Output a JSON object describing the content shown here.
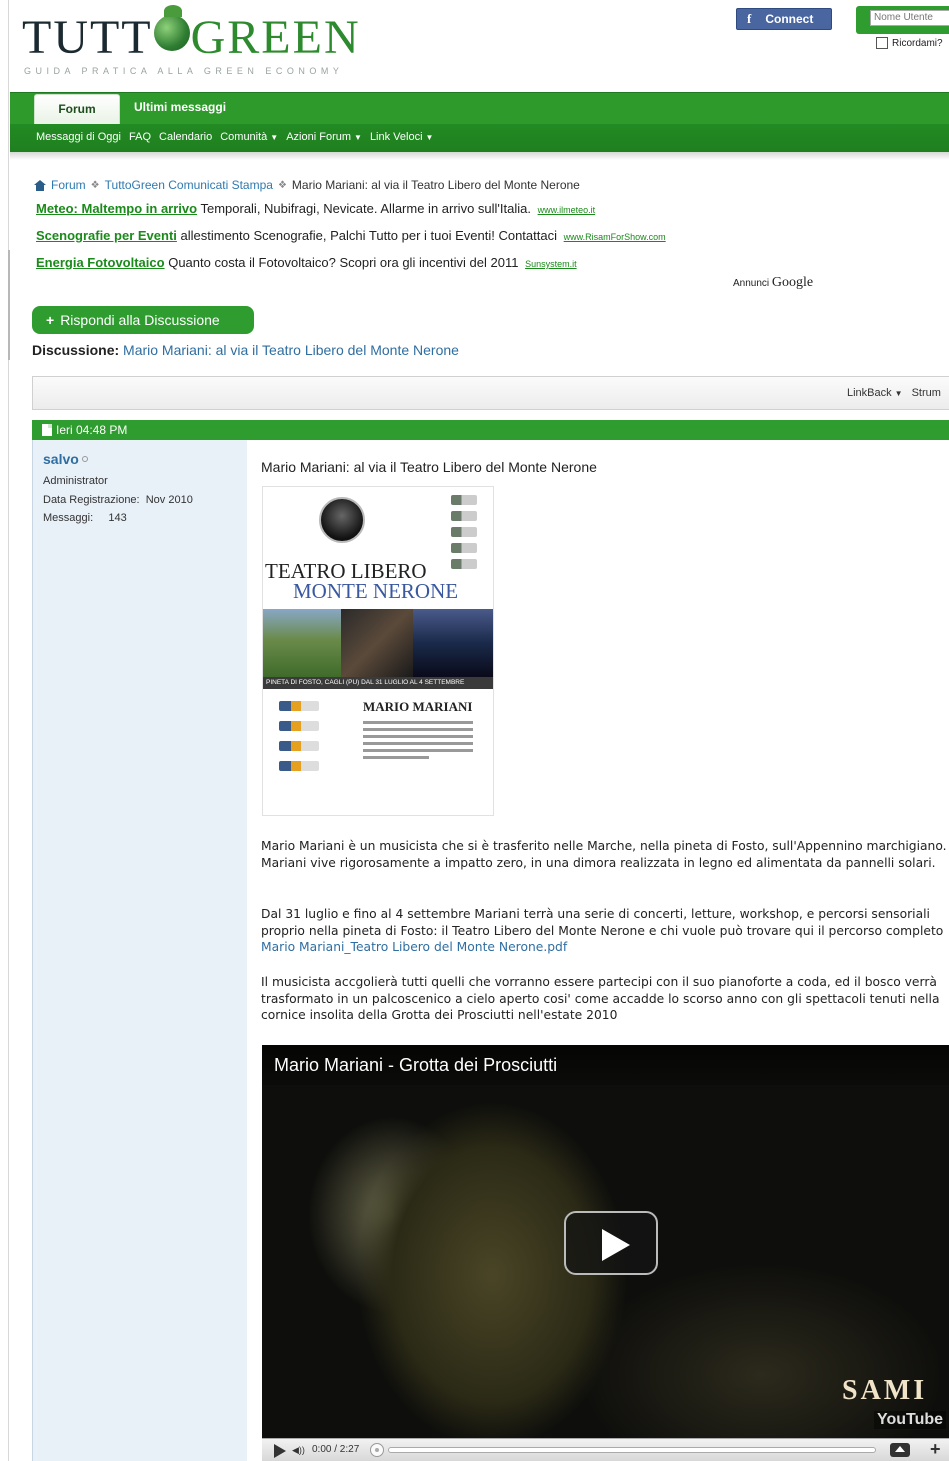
{
  "header": {
    "logo_main": "TUTT",
    "logo_green": "GREEN",
    "tagline": "GUIDA PRATICA ALLA GREEN ECONOMY",
    "fb_label": "Connect",
    "fb_glyph": "f",
    "username_placeholder": "Nome Utente",
    "remember_label": "Ricordami?"
  },
  "nav": {
    "tabs": [
      {
        "label": "Forum"
      },
      {
        "label": "Ultimi messaggi"
      }
    ],
    "subnav": [
      {
        "label": "Messaggi di Oggi"
      },
      {
        "label": "FAQ"
      },
      {
        "label": "Calendario"
      },
      {
        "label": "Comunità"
      },
      {
        "label": "Azioni Forum"
      },
      {
        "label": "Link Veloci"
      }
    ]
  },
  "breadcrumb": {
    "items": [
      "Forum",
      "TuttoGreen Comunicati Stampa",
      "Mario Mariani: al via il Teatro Libero del Monte Nerone"
    ]
  },
  "ads": [
    {
      "title": "Meteo: Maltempo in arrivo",
      "text": "Temporali, Nubifragi, Nevicate. Allarme in arrivo sull'Italia.",
      "url": "www.ilmeteo.it"
    },
    {
      "title": "Scenografie per Eventi",
      "text": "allestimento Scenografie, Palchi Tutto per i tuoi Eventi! Contattaci",
      "url": "www.RisamForShow.com"
    },
    {
      "title": "Energia Fotovoltaico",
      "text": "Quanto costa il Fotovoltaico? Scopri ora gli incentivi del 2011",
      "url": "Sunsystem.it"
    }
  ],
  "annunci": {
    "label": "Annunci",
    "brand": "Google"
  },
  "reply_button": "Rispondi alla Discussione",
  "thread": {
    "prefix": "Discussione:",
    "title": "Mario Mariani: al via il Teatro Libero del Monte Nerone"
  },
  "toolbar": {
    "linkback": "LinkBack",
    "tools": "Strum"
  },
  "post": {
    "date": "Ieri 04:48 PM",
    "user": {
      "name": "salvo",
      "role": "Administrator",
      "reg_label": "Data Registrazione:",
      "reg_value": "Nov 2010",
      "msg_label": "Messaggi:",
      "msg_value": "143"
    },
    "title": "Mario Mariani: al via il Teatro Libero del Monte Nerone",
    "poster": {
      "line1": "TEATRO LIBERO",
      "line2": "MONTE NERONE",
      "band": "PINETA DI FOSTO, CAGLI (PU) DAL 31 LUGLIO AL 4 SETTEMBRE",
      "artist": "MARIO MARIANI"
    },
    "para1": "Mario Mariani è un musicista che si è trasferito nelle Marche, nella pineta di Fosto, sull'Appennino marchigiano. Mariani vive rigorosamente a impatto zero, in una dimora realizzata in legno ed alimentata da pannelli solari.",
    "para2_text": "Dal 31 luglio e fino al 4 settembre Mariani terrà una serie di concerti, letture, workshop, e percorsi sensoriali proprio nella pineta di Fosto: il Teatro Libero del Monte Nerone e chi vuole può trovare qui il percorso completo",
    "para2_link": "Mario Mariani_Teatro Libero del Monte Nerone.pdf",
    "para3": "Il musicista accgolierà tutti quelli che vorranno essere partecipi con il suo pianoforte a coda, ed il bosco verrà trasformato in un palcoscenico a cielo aperto cosi' come accadde lo scorso anno con gli spettacoli tenuti nella cornice insolita della Grotta dei Prosciutti nell'estate 2010"
  },
  "video": {
    "title": "Mario Mariani - Grotta dei Prosciutti",
    "time": "0:00 / 2:27",
    "brand": "SAMI",
    "yt": "YouTube"
  },
  "colors": {
    "brand_green": "#2e9c2e",
    "link_blue": "#2f6ea0",
    "ad_green": "#1a8a1a"
  }
}
